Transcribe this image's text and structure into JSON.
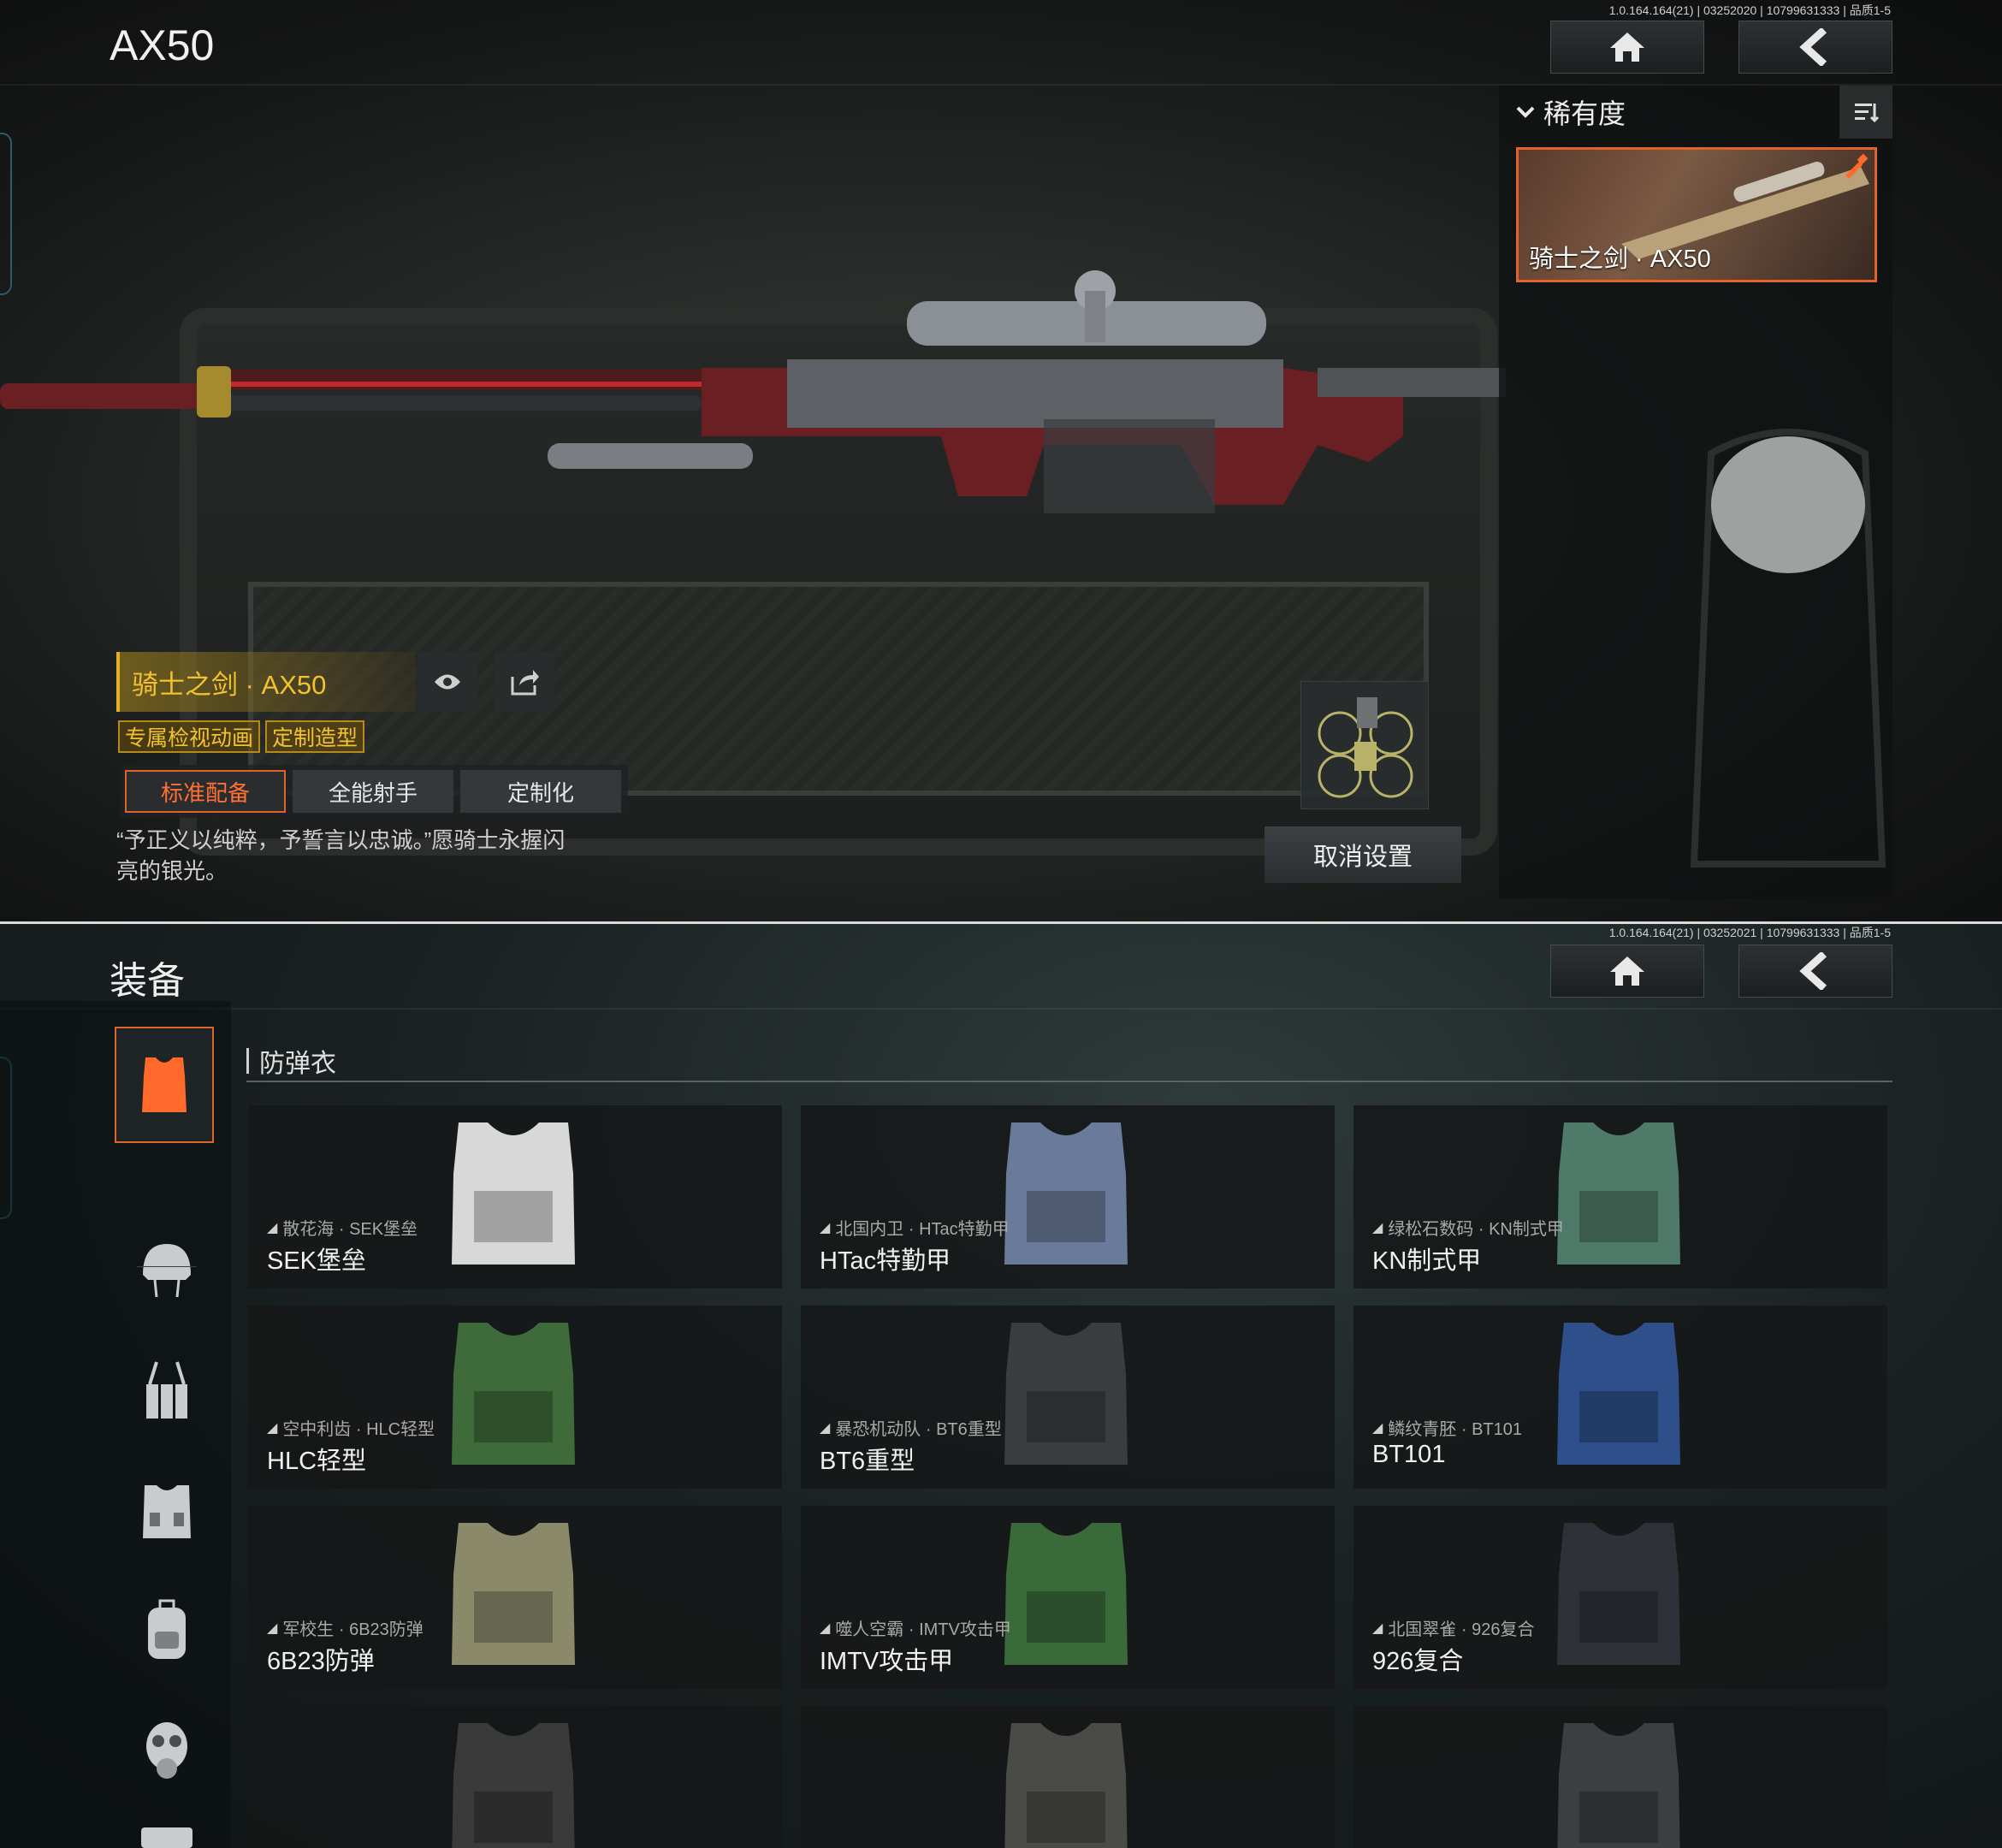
{
  "screen1": {
    "version": "1.0.164.164(21) | 03252020 | 10799631333 | 品质1-5",
    "title": "AX50",
    "panel": {
      "filter_label": "稀有度",
      "skin_card_label": "骑士之剑 · AX50"
    },
    "weapon": {
      "name": "骑士之剑 · AX50",
      "tags": [
        "专属检视动画",
        "定制造型"
      ],
      "tabs": [
        "标准配备",
        "全能射手",
        "定制化"
      ],
      "active_tab": "标准配备",
      "quote": "“予正义以纯粹，予誓言以忠诚。”愿骑士永握闪亮的银光。"
    },
    "cancel_label": "取消设置",
    "colors": {
      "accent": "#e0642a",
      "gold": "#f2c230"
    }
  },
  "screen2": {
    "version": "1.0.164.164(21) | 03252021 | 10799631333 | 品质1-5",
    "title": "装备",
    "section_title": "防弹衣",
    "sidebar_icons": [
      "vest-icon",
      "helmet-icon",
      "chest-rig-icon",
      "armor-plate-icon",
      "backpack-icon",
      "gas-mask-icon",
      "case-icon"
    ],
    "items": [
      {
        "sub": "散花海 · SEK堡垒",
        "name": "SEK堡垒",
        "color": "#d8d8d8"
      },
      {
        "sub": "北国内卫 · HTac特勤甲",
        "name": "HTac特勤甲",
        "color": "#6a7a9a"
      },
      {
        "sub": "绿松石数码 · KN制式甲",
        "name": "KN制式甲",
        "color": "#4f7a6a"
      },
      {
        "sub": "空中利齿 · HLC轻型",
        "name": "HLC轻型",
        "color": "#3f6a3a"
      },
      {
        "sub": "暴恐机动队 · BT6重型",
        "name": "BT6重型",
        "color": "#3a3c3e"
      },
      {
        "sub": "鳞纹青胚 · BT101",
        "name": "BT101",
        "color": "#2f4f8a"
      },
      {
        "sub": "军校生 · 6B23防弹",
        "name": "6B23防弹",
        "color": "#8a8a6a"
      },
      {
        "sub": "噬人空霸 · IMTV攻击甲",
        "name": "IMTV攻击甲",
        "color": "#3a6a3a"
      },
      {
        "sub": "北国翠雀 · 926复合",
        "name": "926复合",
        "color": "#2e3238"
      },
      {
        "sub": "",
        "name": "",
        "color": "#3a3a3a"
      },
      {
        "sub": "",
        "name": "",
        "color": "#4a4a46"
      },
      {
        "sub": "",
        "name": "",
        "color": "#3c3e40"
      }
    ]
  }
}
